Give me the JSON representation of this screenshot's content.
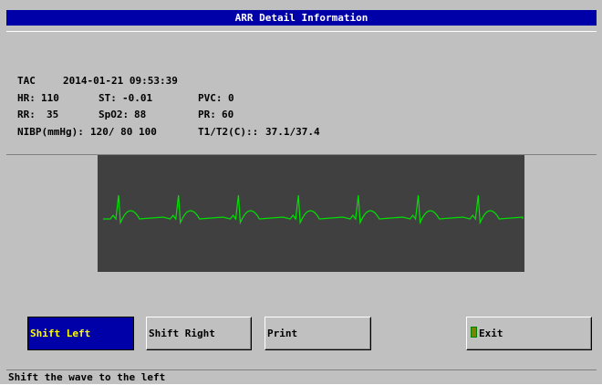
{
  "window": {
    "title": "ARR Detail Information"
  },
  "info": {
    "event": "TAC",
    "datetime": "2014-01-21 09:53:39",
    "hr_label": "HR:",
    "hr_value": "110",
    "st_label": "ST:",
    "st_value": "-0.01",
    "pvc_label": "PVC:",
    "pvc_value": "0",
    "rr_label": "RR:",
    "rr_value": "35",
    "spo2_label": "SpO2:",
    "spo2_value": "88",
    "pr_label": "PR:",
    "pr_value": "60",
    "nibp_label": "NIBP(mmHg):",
    "nibp_value": "120/ 80 100",
    "temp_label": "T1/T2(C)::",
    "temp_value": "37.1/37.4"
  },
  "waveform": {
    "color": "#00e000",
    "beats": 7
  },
  "buttons": {
    "shift_left": "Shift Left",
    "shift_right": "Shift Right",
    "print": "Print",
    "exit": "Exit"
  },
  "status": {
    "text": "Shift the wave to the left"
  },
  "colors": {
    "title_bg": "#0000a8",
    "active_bg": "#0000a8",
    "active_fg": "#ffff00",
    "panel": "#c0c0c0",
    "wave_bg": "#404040"
  }
}
